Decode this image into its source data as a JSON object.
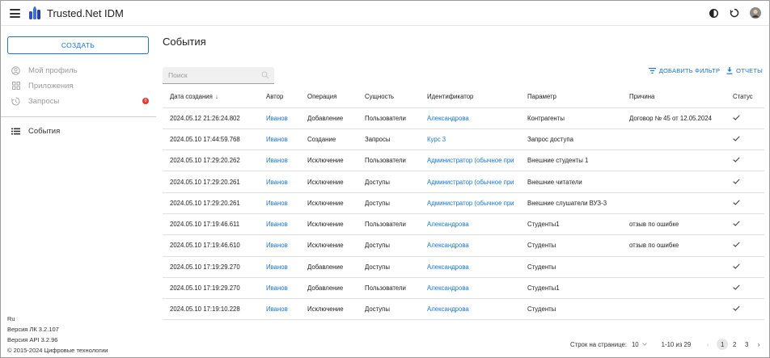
{
  "app": {
    "title": "Trusted.Net IDM"
  },
  "sidebar": {
    "create_label": "СОЗДАТЬ",
    "items": [
      {
        "label": "Мой профиль",
        "icon": "user-circle-icon"
      },
      {
        "label": "Приложения",
        "icon": "apps-grid-icon"
      },
      {
        "label": "Запросы",
        "icon": "history-icon",
        "badge": "0"
      },
      {
        "label": "События",
        "icon": "list-icon"
      }
    ],
    "footer": {
      "lang": "Ru",
      "version_lk": "Версия ЛК 3.2.107",
      "version_api": "Версия API 3.2.96",
      "copyright": "© 2015-2024 Цифровые технологии"
    }
  },
  "main": {
    "title": "События",
    "search_placeholder": "Поиск",
    "add_filter_label": "ДОБАВИТЬ ФИЛЬТР",
    "reports_label": "ОТЧЕТЫ",
    "columns": [
      "Дата создания",
      "Автор",
      "Операция",
      "Сущность",
      "Идентификатор",
      "Параметр",
      "Причина",
      "Статус"
    ],
    "rows": [
      {
        "date": "2024.05.12 21:26:24.802",
        "author": "Иванов",
        "op": "Добавление",
        "entity": "Пользователи",
        "id": "Александрова",
        "param": "Контрагенты",
        "reason": "Договор № 45 от 12.05.2024"
      },
      {
        "date": "2024.05.10 17:44:59.768",
        "author": "Иванов",
        "op": "Создание",
        "entity": "Запросы",
        "id": "Курс 3",
        "param": "Запрос доступа",
        "reason": ""
      },
      {
        "date": "2024.05.10 17:29:20.262",
        "author": "Иванов",
        "op": "Исключение",
        "entity": "Пользователи",
        "id": "Администратор (обычное при",
        "param": "Внешние студенты 1",
        "reason": ""
      },
      {
        "date": "2024.05.10 17:29:20.261",
        "author": "Иванов",
        "op": "Исключение",
        "entity": "Доступы",
        "id": "Администратор (обычное при",
        "param": "Внешние читатели",
        "reason": ""
      },
      {
        "date": "2024.05.10 17:29:20.261",
        "author": "Иванов",
        "op": "Исключение",
        "entity": "Доступы",
        "id": "Администратор (обычное при",
        "param": "Внешние слушатели ВУЗ-3",
        "reason": ""
      },
      {
        "date": "2024.05.10 17:19:46.611",
        "author": "Иванов",
        "op": "Исключение",
        "entity": "Пользователи",
        "id": "Александрова",
        "param": "Студенты1",
        "reason": "отзыв по ошибке"
      },
      {
        "date": "2024.05.10 17:19:46.610",
        "author": "Иванов",
        "op": "Исключение",
        "entity": "Доступы",
        "id": "Александрова",
        "param": "Студенты",
        "reason": "отзыв по ошибке"
      },
      {
        "date": "2024.05.10 17:19:29.270",
        "author": "Иванов",
        "op": "Добавление",
        "entity": "Доступы",
        "id": "Александрова",
        "param": "Студенты",
        "reason": ""
      },
      {
        "date": "2024.05.10 17:19:29.270",
        "author": "Иванов",
        "op": "Добавление",
        "entity": "Пользователи",
        "id": "Александрова",
        "param": "Студенты1",
        "reason": ""
      },
      {
        "date": "2024.05.10 17:19:10.228",
        "author": "Иванов",
        "op": "Исключение",
        "entity": "Доступы",
        "id": "Александрова",
        "param": "Студенты",
        "reason": ""
      }
    ],
    "pagination": {
      "rows_label": "Строк на странице:",
      "rows_value": "10",
      "range": "1-10 из 29",
      "pages": [
        "1",
        "2",
        "3"
      ]
    }
  },
  "colors": {
    "accent": "#1976d2",
    "badge": "#e53935"
  }
}
